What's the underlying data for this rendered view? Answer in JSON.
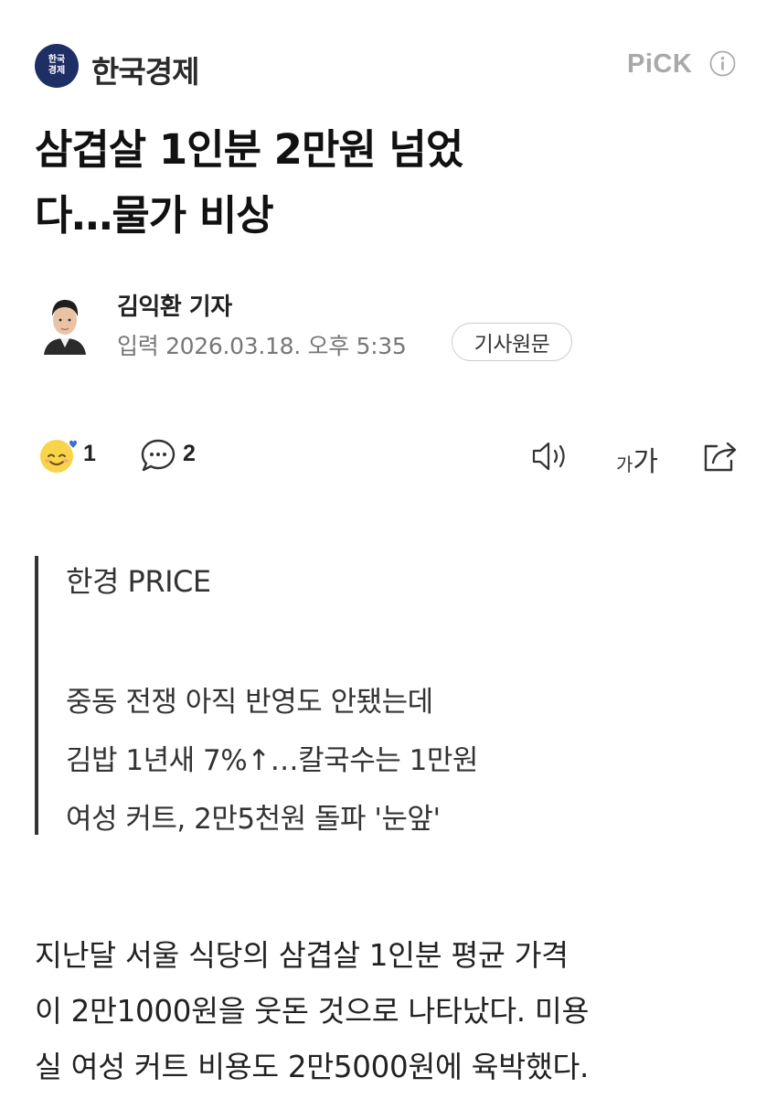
{
  "header": {
    "press_logo_line1": "한국",
    "press_logo_line2": "경제",
    "press_name": "한국경제",
    "pick_label": "PiCK"
  },
  "article": {
    "headline_line1": "삼겹살 1인분 2만원 넘었",
    "headline_line2": "다…물가 비상",
    "reporter": "김익환 기자",
    "date_label": "입력",
    "date_value": "2026.03.18. 오후 5:35",
    "original_button": "기사원문"
  },
  "toolbar": {
    "reaction_count": "1",
    "comment_count": "2",
    "fontsize_small": "가",
    "fontsize_large": "가"
  },
  "summary": {
    "title": "한경 PRICE",
    "lines": [
      "중동 전쟁 아직 반영도 안됐는데",
      "김밥 1년새 7%↑…칼국수는 1만원",
      "여성 커트, 2만5천원 돌파 '눈앞'"
    ]
  },
  "body": {
    "lines": [
      "지난달 서울 식당의 삼겹살 1인분 평균 가격",
      "이 2만1000원을 웃돈 것으로 나타났다. 미용",
      "실 여성 커트 비용도 2만5000원에 육박했다."
    ]
  },
  "colors": {
    "logo_bg": "#1e2f66",
    "pick_gray": "#a9a9a9",
    "text_dark": "#111111",
    "text_meta": "#777777",
    "emoji_yellow": "#f7d44a",
    "heart_blue": "#3b6fd8"
  }
}
